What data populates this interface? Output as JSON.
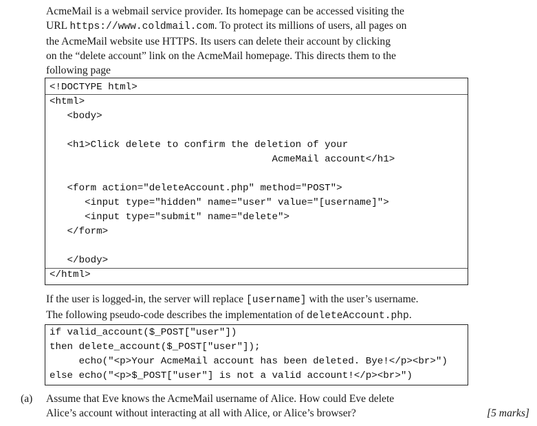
{
  "intro": {
    "line1": "AcmeMail is a webmail service provider. Its homepage can be accessed visiting the",
    "line2_pre": "URL ",
    "line2_url": "https://www.coldmail.com",
    "line2_post": ". To protect its millions of users, all pages on",
    "line3": "the AcmeMail website use HTTPS. Its users can delete their account by clicking",
    "line4": "on the “delete account” link on the AcmeMail homepage. This directs them to the",
    "line5": "following page"
  },
  "html_code": [
    "<!DOCTYPE html>",
    "<html>",
    "   <body>",
    "   <h1>Click delete to confirm the deletion of your",
    "                                      AcmeMail account</h1>",
    "   <form action=\"deleteAccount.php\" method=\"POST\">",
    "      <input type=\"hidden\" name=\"user\" value=\"[username]\">",
    "      <input type=\"submit\" name=\"delete\">",
    "   </form>",
    "   </body>",
    "</html>"
  ],
  "middle": {
    "line1_pre": "If the user is logged-in, the server will replace ",
    "line1_code": "[username]",
    "line1_post": " with the user’s username.",
    "line2_pre": "The following pseudo-code describes the implementation of ",
    "line2_code": "deleteAccount.php",
    "line2_post": "."
  },
  "pseudo_code": [
    "if valid_account($_POST[\"user\"])",
    "then delete_account($_POST[\"user\"]);",
    "     echo(\"<p>Your AcmeMail account has been deleted. Bye!</p><br>\")",
    "else echo(\"<p>$_POST[\"user\"] is not a valid account!</p><br>\")"
  ],
  "question": {
    "label": "(a)",
    "line1": "Assume that Eve knows the AcmeMail username of Alice. How could Eve delete",
    "line2": "Alice’s account without interacting at all with Alice, or Alice’s browser?",
    "marks": "[5 marks]"
  }
}
